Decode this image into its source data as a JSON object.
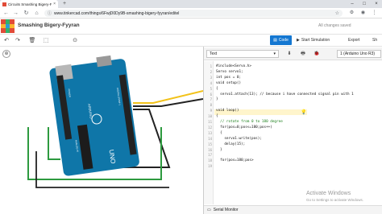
{
  "browser": {
    "tab_title": "Circuits Smashing Bigery-F...",
    "tab_close": "×",
    "new_tab": "+",
    "url": "www.tinkercad.com/things/6FwjD0Dy9B-smashing-bigery-fyyran/editel",
    "lock": "ⓘ",
    "star": "☆",
    "window_controls": [
      "–",
      "□",
      "×"
    ],
    "nav": [
      "←",
      "→",
      "↻",
      "⌂"
    ],
    "extensions": [
      "⚙",
      "◉",
      "⋮"
    ]
  },
  "app": {
    "project_name": "Smashing Bigery-Fyyran",
    "save_status": "All changes saved"
  },
  "toolbar": {
    "tools": [
      "↶",
      "↷",
      "🗑",
      "⬚",
      "⊙"
    ],
    "code_label": "Code",
    "start_sim_label": "Start Simulation",
    "export_label": "Export",
    "share_label": "Sh"
  },
  "code_panel": {
    "mode": "Text",
    "mode_caret": "▾",
    "icons": [
      "⬇",
      "🖶",
      "🐞"
    ],
    "board": "1 (Arduino Uno R3)",
    "lines": [
      {
        "n": "1",
        "t": "#include<Servo.h>",
        "c": false
      },
      {
        "n": "2",
        "t": "Servo servo1;",
        "c": false
      },
      {
        "n": "3",
        "t": "int pos = 0;",
        "c": false
      },
      {
        "n": "4",
        "t": "void setup()",
        "c": false
      },
      {
        "n": "5",
        "t": "{",
        "c": false
      },
      {
        "n": "6",
        "t": "  servo1.attach(13); // because i have connected signal pin with 1",
        "c": false
      },
      {
        "n": "7",
        "t": "}",
        "c": false
      },
      {
        "n": "8",
        "t": "",
        "c": false
      },
      {
        "n": "9",
        "t": "void loop()",
        "c": false
      },
      {
        "n": "10",
        "t": "{",
        "c": false
      },
      {
        "n": "11",
        "t": "  // rotate from 0 to 180 degree",
        "c": true
      },
      {
        "n": "12",
        "t": "  for(pos=0;pos<=180;pos++)",
        "c": false
      },
      {
        "n": "13",
        "t": "  {",
        "c": false
      },
      {
        "n": "14",
        "t": "    servo1.write(pos);",
        "c": false
      },
      {
        "n": "15",
        "t": "    delay(15);",
        "c": false
      },
      {
        "n": "16",
        "t": "  }",
        "c": false
      },
      {
        "n": "17",
        "t": "",
        "c": false
      },
      {
        "n": "18",
        "t": "  for(pos=180;pos>",
        "c": false
      },
      {
        "n": "19",
        "t": "",
        "c": false
      }
    ],
    "serial_monitor": "Serial Monitor"
  },
  "board": {
    "brand": "UNO",
    "make": "ARDUINO",
    "digital_label": "DIGITAL (PWM~)",
    "analog_label": "ANALOG IN",
    "power_label": "POWER"
  },
  "watermark": {
    "title": "Activate Windows",
    "subtitle": "Go to Settings to activate Windows."
  },
  "colors": {
    "code_button": "#1477d1",
    "board": "#0f76a8",
    "wire_yellow": "#f2c21a",
    "wire_black": "#222222",
    "wire_green": "#2d9a3f",
    "comment": "#1b7f1b"
  }
}
